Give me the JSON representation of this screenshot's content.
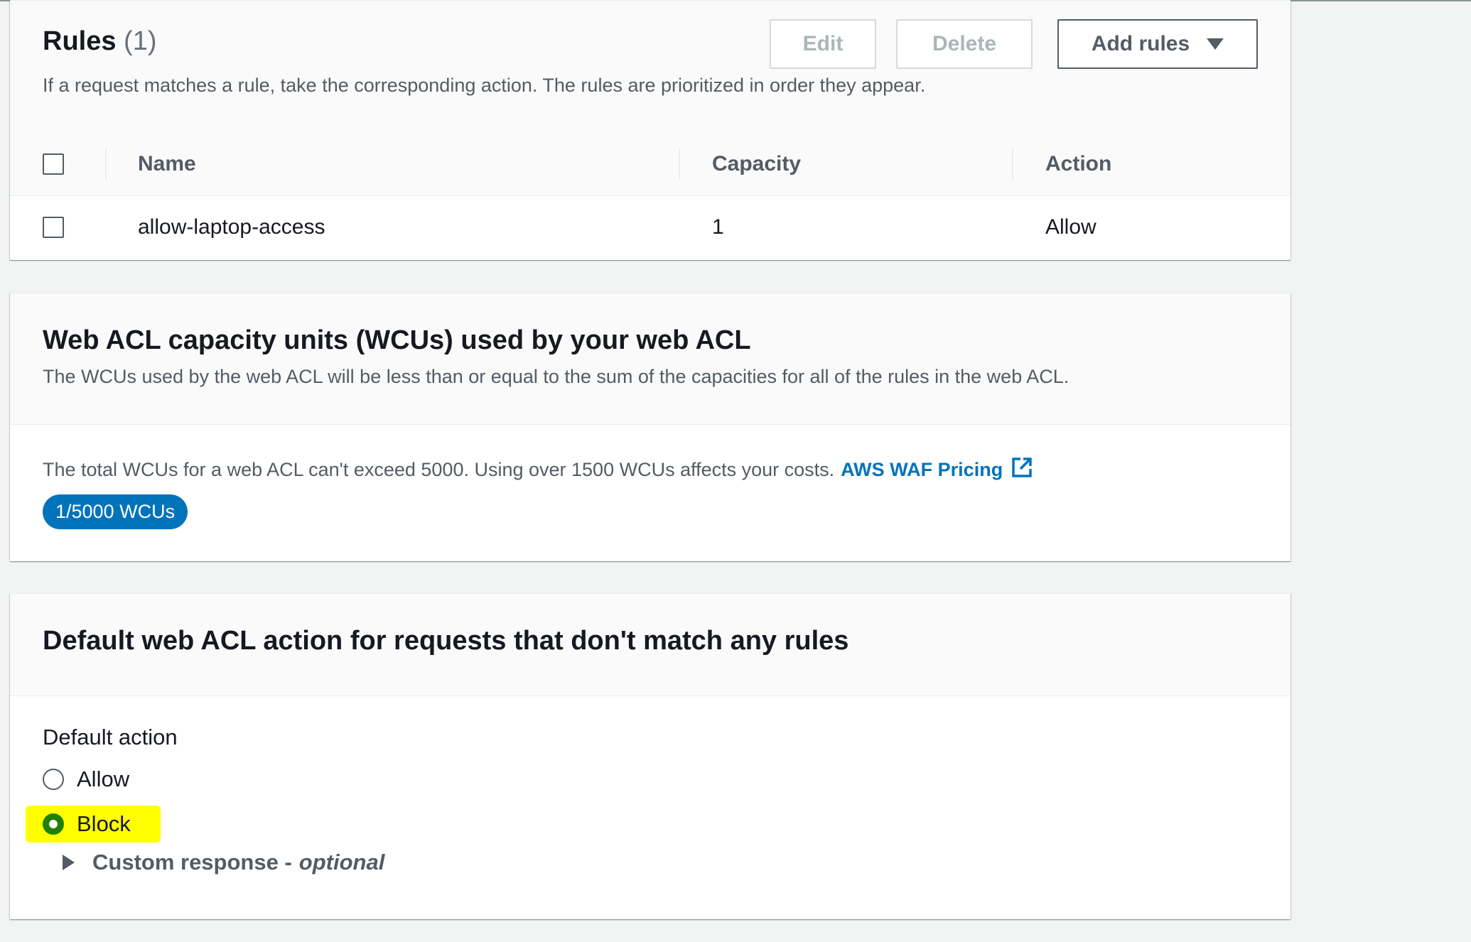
{
  "rules_panel": {
    "title": "Rules",
    "count": "(1)",
    "description": "If a request matches a rule, take the corresponding action. The rules are prioritized in order they appear.",
    "buttons": {
      "edit": "Edit",
      "delete": "Delete",
      "add_rules": "Add rules"
    },
    "columns": [
      "Name",
      "Capacity",
      "Action"
    ],
    "rows": [
      {
        "name": "allow-laptop-access",
        "capacity": "1",
        "action": "Allow"
      }
    ]
  },
  "wcu_panel": {
    "title": "Web ACL capacity units (WCUs) used by your web ACL",
    "description": "The WCUs used by the web ACL will be less than or equal to the sum of the capacities for all of the rules in the web ACL.",
    "limit_text": "The total WCUs for a web ACL can't exceed 5000. Using over 1500 WCUs affects your costs.",
    "pricing_link": "AWS WAF Pricing",
    "pricing_icon": "external-link-icon",
    "badge": "1/5000 WCUs"
  },
  "default_action_panel": {
    "title": "Default web ACL action for requests that don't match any rules",
    "field_label": "Default action",
    "options": [
      {
        "label": "Allow",
        "selected": false
      },
      {
        "label": "Block",
        "selected": true
      }
    ],
    "custom_response": {
      "label": "Custom response -",
      "optional": "optional"
    }
  },
  "colors": {
    "link": "#0073bb",
    "badge_bg": "#0073bb",
    "highlight": "#ffff00",
    "selected_radio": "#1d8102"
  }
}
